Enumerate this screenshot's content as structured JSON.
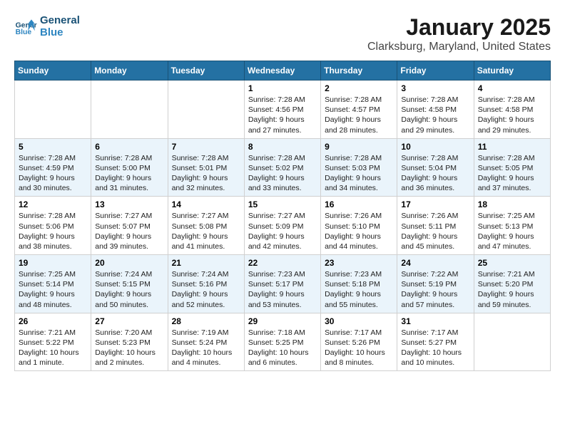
{
  "header": {
    "logo_line1": "General",
    "logo_line2": "Blue",
    "month": "January 2025",
    "location": "Clarksburg, Maryland, United States"
  },
  "weekdays": [
    "Sunday",
    "Monday",
    "Tuesday",
    "Wednesday",
    "Thursday",
    "Friday",
    "Saturday"
  ],
  "weeks": [
    [
      {
        "day": "",
        "info": ""
      },
      {
        "day": "",
        "info": ""
      },
      {
        "day": "",
        "info": ""
      },
      {
        "day": "1",
        "info": "Sunrise: 7:28 AM\nSunset: 4:56 PM\nDaylight: 9 hours\nand 27 minutes."
      },
      {
        "day": "2",
        "info": "Sunrise: 7:28 AM\nSunset: 4:57 PM\nDaylight: 9 hours\nand 28 minutes."
      },
      {
        "day": "3",
        "info": "Sunrise: 7:28 AM\nSunset: 4:58 PM\nDaylight: 9 hours\nand 29 minutes."
      },
      {
        "day": "4",
        "info": "Sunrise: 7:28 AM\nSunset: 4:58 PM\nDaylight: 9 hours\nand 29 minutes."
      }
    ],
    [
      {
        "day": "5",
        "info": "Sunrise: 7:28 AM\nSunset: 4:59 PM\nDaylight: 9 hours\nand 30 minutes."
      },
      {
        "day": "6",
        "info": "Sunrise: 7:28 AM\nSunset: 5:00 PM\nDaylight: 9 hours\nand 31 minutes."
      },
      {
        "day": "7",
        "info": "Sunrise: 7:28 AM\nSunset: 5:01 PM\nDaylight: 9 hours\nand 32 minutes."
      },
      {
        "day": "8",
        "info": "Sunrise: 7:28 AM\nSunset: 5:02 PM\nDaylight: 9 hours\nand 33 minutes."
      },
      {
        "day": "9",
        "info": "Sunrise: 7:28 AM\nSunset: 5:03 PM\nDaylight: 9 hours\nand 34 minutes."
      },
      {
        "day": "10",
        "info": "Sunrise: 7:28 AM\nSunset: 5:04 PM\nDaylight: 9 hours\nand 36 minutes."
      },
      {
        "day": "11",
        "info": "Sunrise: 7:28 AM\nSunset: 5:05 PM\nDaylight: 9 hours\nand 37 minutes."
      }
    ],
    [
      {
        "day": "12",
        "info": "Sunrise: 7:28 AM\nSunset: 5:06 PM\nDaylight: 9 hours\nand 38 minutes."
      },
      {
        "day": "13",
        "info": "Sunrise: 7:27 AM\nSunset: 5:07 PM\nDaylight: 9 hours\nand 39 minutes."
      },
      {
        "day": "14",
        "info": "Sunrise: 7:27 AM\nSunset: 5:08 PM\nDaylight: 9 hours\nand 41 minutes."
      },
      {
        "day": "15",
        "info": "Sunrise: 7:27 AM\nSunset: 5:09 PM\nDaylight: 9 hours\nand 42 minutes."
      },
      {
        "day": "16",
        "info": "Sunrise: 7:26 AM\nSunset: 5:10 PM\nDaylight: 9 hours\nand 44 minutes."
      },
      {
        "day": "17",
        "info": "Sunrise: 7:26 AM\nSunset: 5:11 PM\nDaylight: 9 hours\nand 45 minutes."
      },
      {
        "day": "18",
        "info": "Sunrise: 7:25 AM\nSunset: 5:13 PM\nDaylight: 9 hours\nand 47 minutes."
      }
    ],
    [
      {
        "day": "19",
        "info": "Sunrise: 7:25 AM\nSunset: 5:14 PM\nDaylight: 9 hours\nand 48 minutes."
      },
      {
        "day": "20",
        "info": "Sunrise: 7:24 AM\nSunset: 5:15 PM\nDaylight: 9 hours\nand 50 minutes."
      },
      {
        "day": "21",
        "info": "Sunrise: 7:24 AM\nSunset: 5:16 PM\nDaylight: 9 hours\nand 52 minutes."
      },
      {
        "day": "22",
        "info": "Sunrise: 7:23 AM\nSunset: 5:17 PM\nDaylight: 9 hours\nand 53 minutes."
      },
      {
        "day": "23",
        "info": "Sunrise: 7:23 AM\nSunset: 5:18 PM\nDaylight: 9 hours\nand 55 minutes."
      },
      {
        "day": "24",
        "info": "Sunrise: 7:22 AM\nSunset: 5:19 PM\nDaylight: 9 hours\nand 57 minutes."
      },
      {
        "day": "25",
        "info": "Sunrise: 7:21 AM\nSunset: 5:20 PM\nDaylight: 9 hours\nand 59 minutes."
      }
    ],
    [
      {
        "day": "26",
        "info": "Sunrise: 7:21 AM\nSunset: 5:22 PM\nDaylight: 10 hours\nand 1 minute."
      },
      {
        "day": "27",
        "info": "Sunrise: 7:20 AM\nSunset: 5:23 PM\nDaylight: 10 hours\nand 2 minutes."
      },
      {
        "day": "28",
        "info": "Sunrise: 7:19 AM\nSunset: 5:24 PM\nDaylight: 10 hours\nand 4 minutes."
      },
      {
        "day": "29",
        "info": "Sunrise: 7:18 AM\nSunset: 5:25 PM\nDaylight: 10 hours\nand 6 minutes."
      },
      {
        "day": "30",
        "info": "Sunrise: 7:17 AM\nSunset: 5:26 PM\nDaylight: 10 hours\nand 8 minutes."
      },
      {
        "day": "31",
        "info": "Sunrise: 7:17 AM\nSunset: 5:27 PM\nDaylight: 10 hours\nand 10 minutes."
      },
      {
        "day": "",
        "info": ""
      }
    ]
  ]
}
